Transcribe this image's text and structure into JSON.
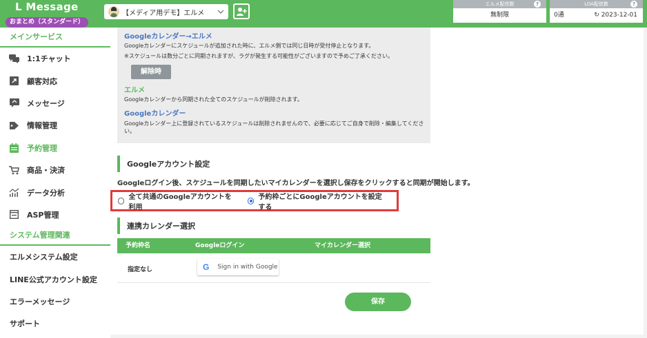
{
  "header": {
    "logo": "L Message",
    "plan": "おまとめ（スタンダード）",
    "account_name": "【メディア用デモ】エルメ",
    "delivery": {
      "label": "エルメ配信数",
      "value": "無制限"
    },
    "loa": {
      "label": "LOA配信数",
      "value": "0通",
      "date": "2023-12-01"
    },
    "colors": {
      "brand": "#5cb85c",
      "plan_badge": "#9c4fb4",
      "highlight": "#e03a3a"
    }
  },
  "sidebar": {
    "main_title": "メインサービス",
    "items": [
      {
        "label": "1:1チャット",
        "icon": "chat-icon"
      },
      {
        "label": "顧客対応",
        "icon": "share-icon"
      },
      {
        "label": "メッセージ",
        "icon": "message-icon"
      },
      {
        "label": "情報管理",
        "icon": "tag-icon"
      },
      {
        "label": "予約管理",
        "icon": "calendar-icon",
        "active": true
      },
      {
        "label": "商品・決済",
        "icon": "cart-icon"
      },
      {
        "label": "データ分析",
        "icon": "chart-icon"
      },
      {
        "label": "ASP管理",
        "icon": "asp-icon"
      }
    ],
    "system_title": "システム管理関連",
    "system_items": [
      {
        "label": "エルメシステム設定"
      },
      {
        "label": "LINE公式アカウント設定"
      },
      {
        "label": "エラーメッセージ"
      },
      {
        "label": "サポート"
      }
    ]
  },
  "info": {
    "h1": "Googleカレンダー→エルメ",
    "t1": "Googleカレンダーにスケジュールが追加された時に、エルメ側では同じ日時が受付停止となります。",
    "t2": "※スケジュールは数分ごとに同期されますが、ラグが発生する可能性がございますので予めご了承ください。",
    "release_btn": "解除時",
    "h2": "エルメ",
    "t3": "Googleカレンダーから同期された全てのスケジュールが削除されます。",
    "h3": "Googleカレンダー",
    "t4": "Googleカレンダー上に登録されているスケジュールは削除されませんので、必要に応じてご自身で削除・編集してください。"
  },
  "account_settings": {
    "title": "Googleアカウント設定",
    "description": "Googleログイン後、スケジュールを同期したいマイカレンダーを選択し保存をクリックすると同期が開始します。",
    "option_shared": "全て共通のGoogleアカウントを利用",
    "option_per_slot": "予約枠ごとにGoogleアカウントを設定する",
    "selected": "option_per_slot"
  },
  "calendar_select": {
    "title": "連携カレンダー選択",
    "columns": [
      "予約枠名",
      "Googleログイン",
      "マイカレンダー選択"
    ],
    "rows": [
      {
        "slot": "指定なし",
        "google_btn": "Sign in with Google",
        "calendar": ""
      }
    ]
  },
  "save_label": "保存"
}
